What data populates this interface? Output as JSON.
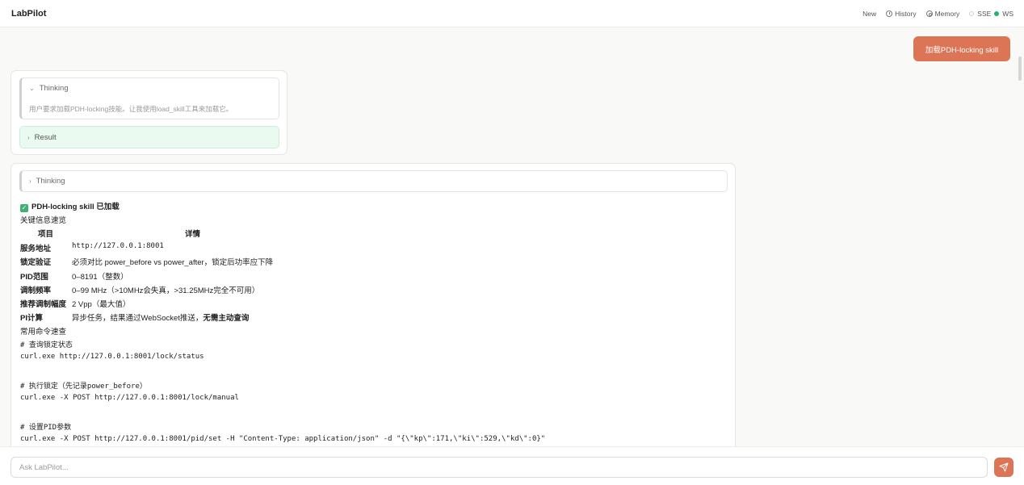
{
  "header": {
    "brand": "LabPilot",
    "nav": {
      "new": "New",
      "history": "History",
      "memory": "Memory"
    },
    "status": {
      "sse": "SSE",
      "ws": "WS"
    }
  },
  "messages": {
    "user": "加载PDH-locking skill",
    "first": {
      "thinking_label": "Thinking",
      "thinking_text": "用户要求加载PDH-locking技能。让我使用load_skill工具来加载它。",
      "result_label": "Result"
    },
    "second": {
      "thinking_label": "Thinking",
      "loaded_title": "PDH-locking skill 已加载",
      "overview_label": "关键信息速览",
      "table_headers": [
        "项目",
        "详情"
      ],
      "rows": [
        {
          "key": "服务地址",
          "value": "http://127.0.0.1:8001"
        },
        {
          "key": "锁定验证",
          "value": "必须对比 power_before vs power_after，锁定后功率应下降"
        },
        {
          "key": "PID范围",
          "value": "0–8191（整数）"
        },
        {
          "key": "调制频率",
          "value": "0–99 MHz（>10MHz会失真，>31.25MHz完全不可用）"
        },
        {
          "key": "推荐调制幅度",
          "value": "2 Vpp（最大值）"
        },
        {
          "key": "PI计算",
          "value": "异步任务，结果通过WebSocket推送，",
          "value_bold": "无需主动查询"
        }
      ],
      "commands_label": "常用命令速查",
      "code": [
        "# 查询锁定状态",
        "curl.exe http://127.0.0.1:8001/lock/status",
        "",
        "# 执行锁定（先记录power_before）",
        "curl.exe -X POST http://127.0.0.1:8001/lock/manual",
        "",
        "# 设置PID参数",
        "curl.exe -X POST http://127.0.0.1:8001/pid/set -H \"Content-Type: application/json\" -d \"{\\\"kp\\\":171,\\\"ki\\\":529,\\\"kd\\\":0}\""
      ]
    }
  },
  "input": {
    "placeholder": "Ask LabPilot..."
  },
  "colors": {
    "accent": "#dc7456",
    "success": "#23b26d"
  }
}
